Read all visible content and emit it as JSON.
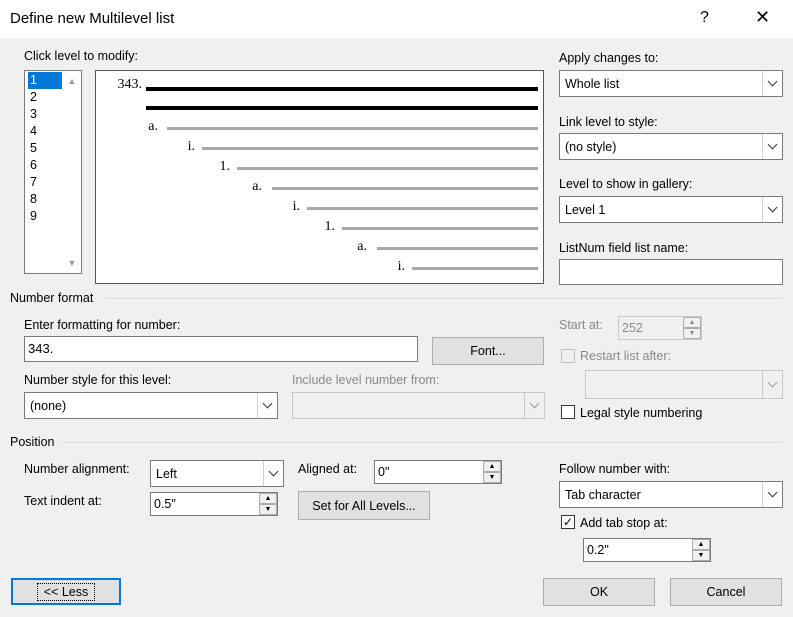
{
  "dialog": {
    "title": "Define new Multilevel list",
    "help": "?",
    "close": "✕"
  },
  "levels": {
    "label": "Click level to modify:",
    "items": [
      "1",
      "2",
      "3",
      "4",
      "5",
      "6",
      "7",
      "8",
      "9"
    ],
    "selected": "1"
  },
  "preview": {
    "numbers": [
      "343.",
      "a.",
      "i.",
      "1.",
      "a.",
      "i.",
      "1.",
      "a.",
      "i."
    ]
  },
  "apply_changes": {
    "label": "Apply changes to:",
    "value": "Whole list"
  },
  "link_style": {
    "label": "Link level to style:",
    "value": "(no style)"
  },
  "gallery_level": {
    "label": "Level to show in gallery:",
    "value": "Level 1"
  },
  "listnum": {
    "label": "ListNum field list name:",
    "value": ""
  },
  "number_format": {
    "section": "Number format",
    "enter_label": "Enter formatting for number:",
    "enter_value": "343.",
    "font_button": "Font...",
    "style_label": "Number style for this level:",
    "style_value": "(none)",
    "include_label": "Include level number from:",
    "include_value": "",
    "start_label": "Start at:",
    "start_value": "252",
    "restart_label": "Restart list after:",
    "restart_value": "",
    "legal_label": "Legal style numbering"
  },
  "position": {
    "section": "Position",
    "alignment_label": "Number alignment:",
    "alignment_value": "Left",
    "aligned_label": "Aligned at:",
    "aligned_value": "0\"",
    "indent_label": "Text indent at:",
    "indent_value": "0.5\"",
    "set_all_button": "Set for All Levels...",
    "follow_label": "Follow number with:",
    "follow_value": "Tab character",
    "tabstop_label": "Add tab stop at:",
    "tabstop_checked": true,
    "tabstop_value": "0.2\""
  },
  "footer": {
    "less": "<< Less",
    "ok": "OK",
    "cancel": "Cancel"
  },
  "colors": {
    "accent": "#0078d7",
    "preview_dark": "#000000",
    "preview_gray": "#a8a8a8"
  }
}
